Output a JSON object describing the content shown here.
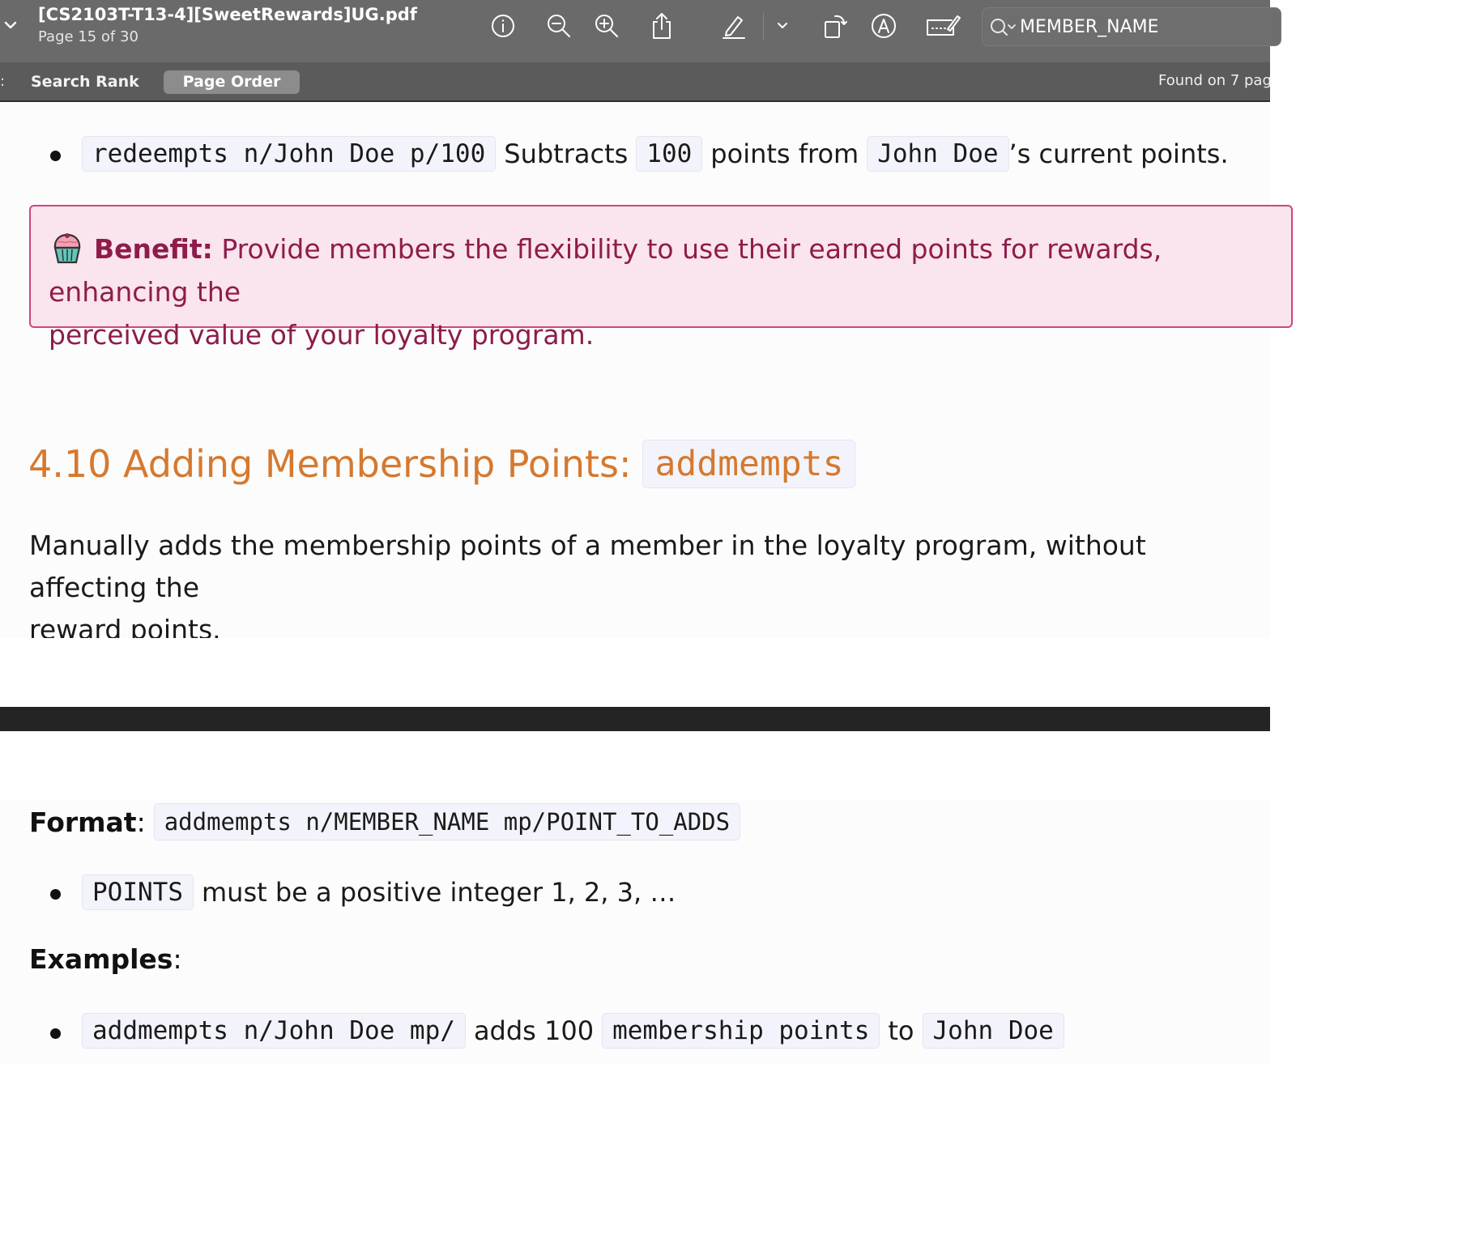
{
  "toolbar": {
    "doc_title": "[CS2103T-T13-4][SweetRewards]UG.pdf",
    "page_indicator": "Page 15 of 30",
    "icons": [
      "chevron-down-icon",
      "info-icon",
      "zoom-out-icon",
      "zoom-in-icon",
      "share-icon",
      "highlight-pen-icon",
      "chevron-down-icon",
      "rotate-icon",
      "markup-icon",
      "form-fill-icon",
      "search-icon"
    ],
    "search_value": "MEMBER_NAME"
  },
  "results_bar": {
    "colon": ":",
    "tabs": [
      "Search Rank",
      "Page Order"
    ],
    "selected_tab": "Page Order",
    "found_text": "Found on 7 pag"
  },
  "content": {
    "redeem_example": {
      "command": "redeempts n/John Doe p/100",
      "t1": "Subtracts",
      "amount": "100",
      "t2": "points from",
      "name": "John Doe",
      "t3": "’s current points."
    },
    "benefit": {
      "label": "Benefit:",
      "line1": "Provide members the flexibility to use their earned points for rewards, enhancing the",
      "line2": "perceived value of your loyalty program.",
      "colors": {
        "border": "#d1457f",
        "background": "#fae4ee",
        "text": "#8e1c4a"
      }
    },
    "section": {
      "heading": "4.10 Adding Membership Points:",
      "command": "addmempts",
      "color": "#d5792f",
      "description_line1": "Manually adds the membership points of a member in the loyalty program, without affecting the",
      "description_line2": "reward points."
    },
    "format": {
      "label": "Format",
      "colon": ":",
      "command": "addmempts n/MEMBER_NAME mp/POINT_TO_ADDS"
    },
    "points_rule": {
      "code": "POINTS",
      "text": "must be a positive integer 1, 2, 3, …"
    },
    "examples": {
      "label": "Examples",
      "colon": ":",
      "command": "addmempts n/John Doe mp/",
      "t1": "adds 100",
      "code2": "membership points",
      "t2": "to",
      "name": "John Doe"
    }
  }
}
